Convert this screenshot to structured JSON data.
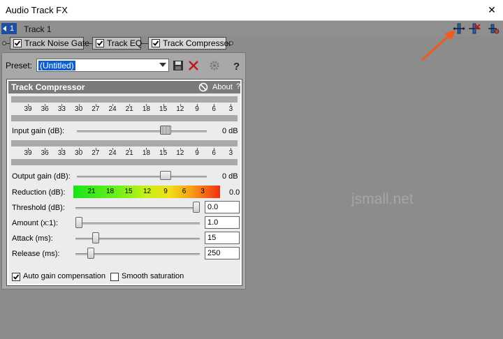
{
  "window": {
    "title": "Audio Track FX",
    "close_glyph": "✕"
  },
  "track": {
    "number": "1",
    "name": "Track 1"
  },
  "toolbar_icons": [
    "plugin-chain-icon",
    "remove-plugin-icon",
    "plugin-settings-icon"
  ],
  "chain": {
    "plugins": [
      {
        "label": "Track Noise Gate",
        "checked": true,
        "active": false
      },
      {
        "label": "Track EQ",
        "checked": true,
        "active": false
      },
      {
        "label": "Track Compressor",
        "checked": true,
        "active": true
      }
    ]
  },
  "preset": {
    "label": "Preset:",
    "value": "(Untitled)"
  },
  "compressor": {
    "title": "Track Compressor",
    "about": "About",
    "help": "?",
    "scale_ticks": [
      "39",
      "36",
      "33",
      "30",
      "27",
      "24",
      "21",
      "18",
      "15",
      "12",
      "9",
      "6",
      "3"
    ],
    "input_gain": {
      "label": "Input gain (dB):",
      "value": "0 dB",
      "level": 0.7
    },
    "output_gain": {
      "label": "Output gain (dB):",
      "value": "0 dB",
      "level": 0.7
    },
    "reduction": {
      "label": "Reduction (dB):",
      "ticks": [
        "21",
        "18",
        "15",
        "12",
        "9",
        "6",
        "3"
      ],
      "value": "0.0"
    },
    "threshold": {
      "label": "Threshold (dB):",
      "value": "0.0",
      "level": 1.0
    },
    "amount": {
      "label": "Amount (x:1):",
      "value": "1.0",
      "level": 0.0
    },
    "attack": {
      "label": "Attack (ms):",
      "value": "15",
      "level": 0.14
    },
    "release": {
      "label": "Release (ms):",
      "value": "250",
      "level": 0.1
    },
    "auto_gain": {
      "label": "Auto gain compensation",
      "checked": true
    },
    "smooth_saturation": {
      "label": "Smooth saturation",
      "checked": false
    }
  },
  "watermark": "jsmall.net",
  "colors": {
    "accent": "#0d5fce",
    "annotation_arrow": "#f05a1e",
    "track_badge": "#1f4fa0"
  }
}
